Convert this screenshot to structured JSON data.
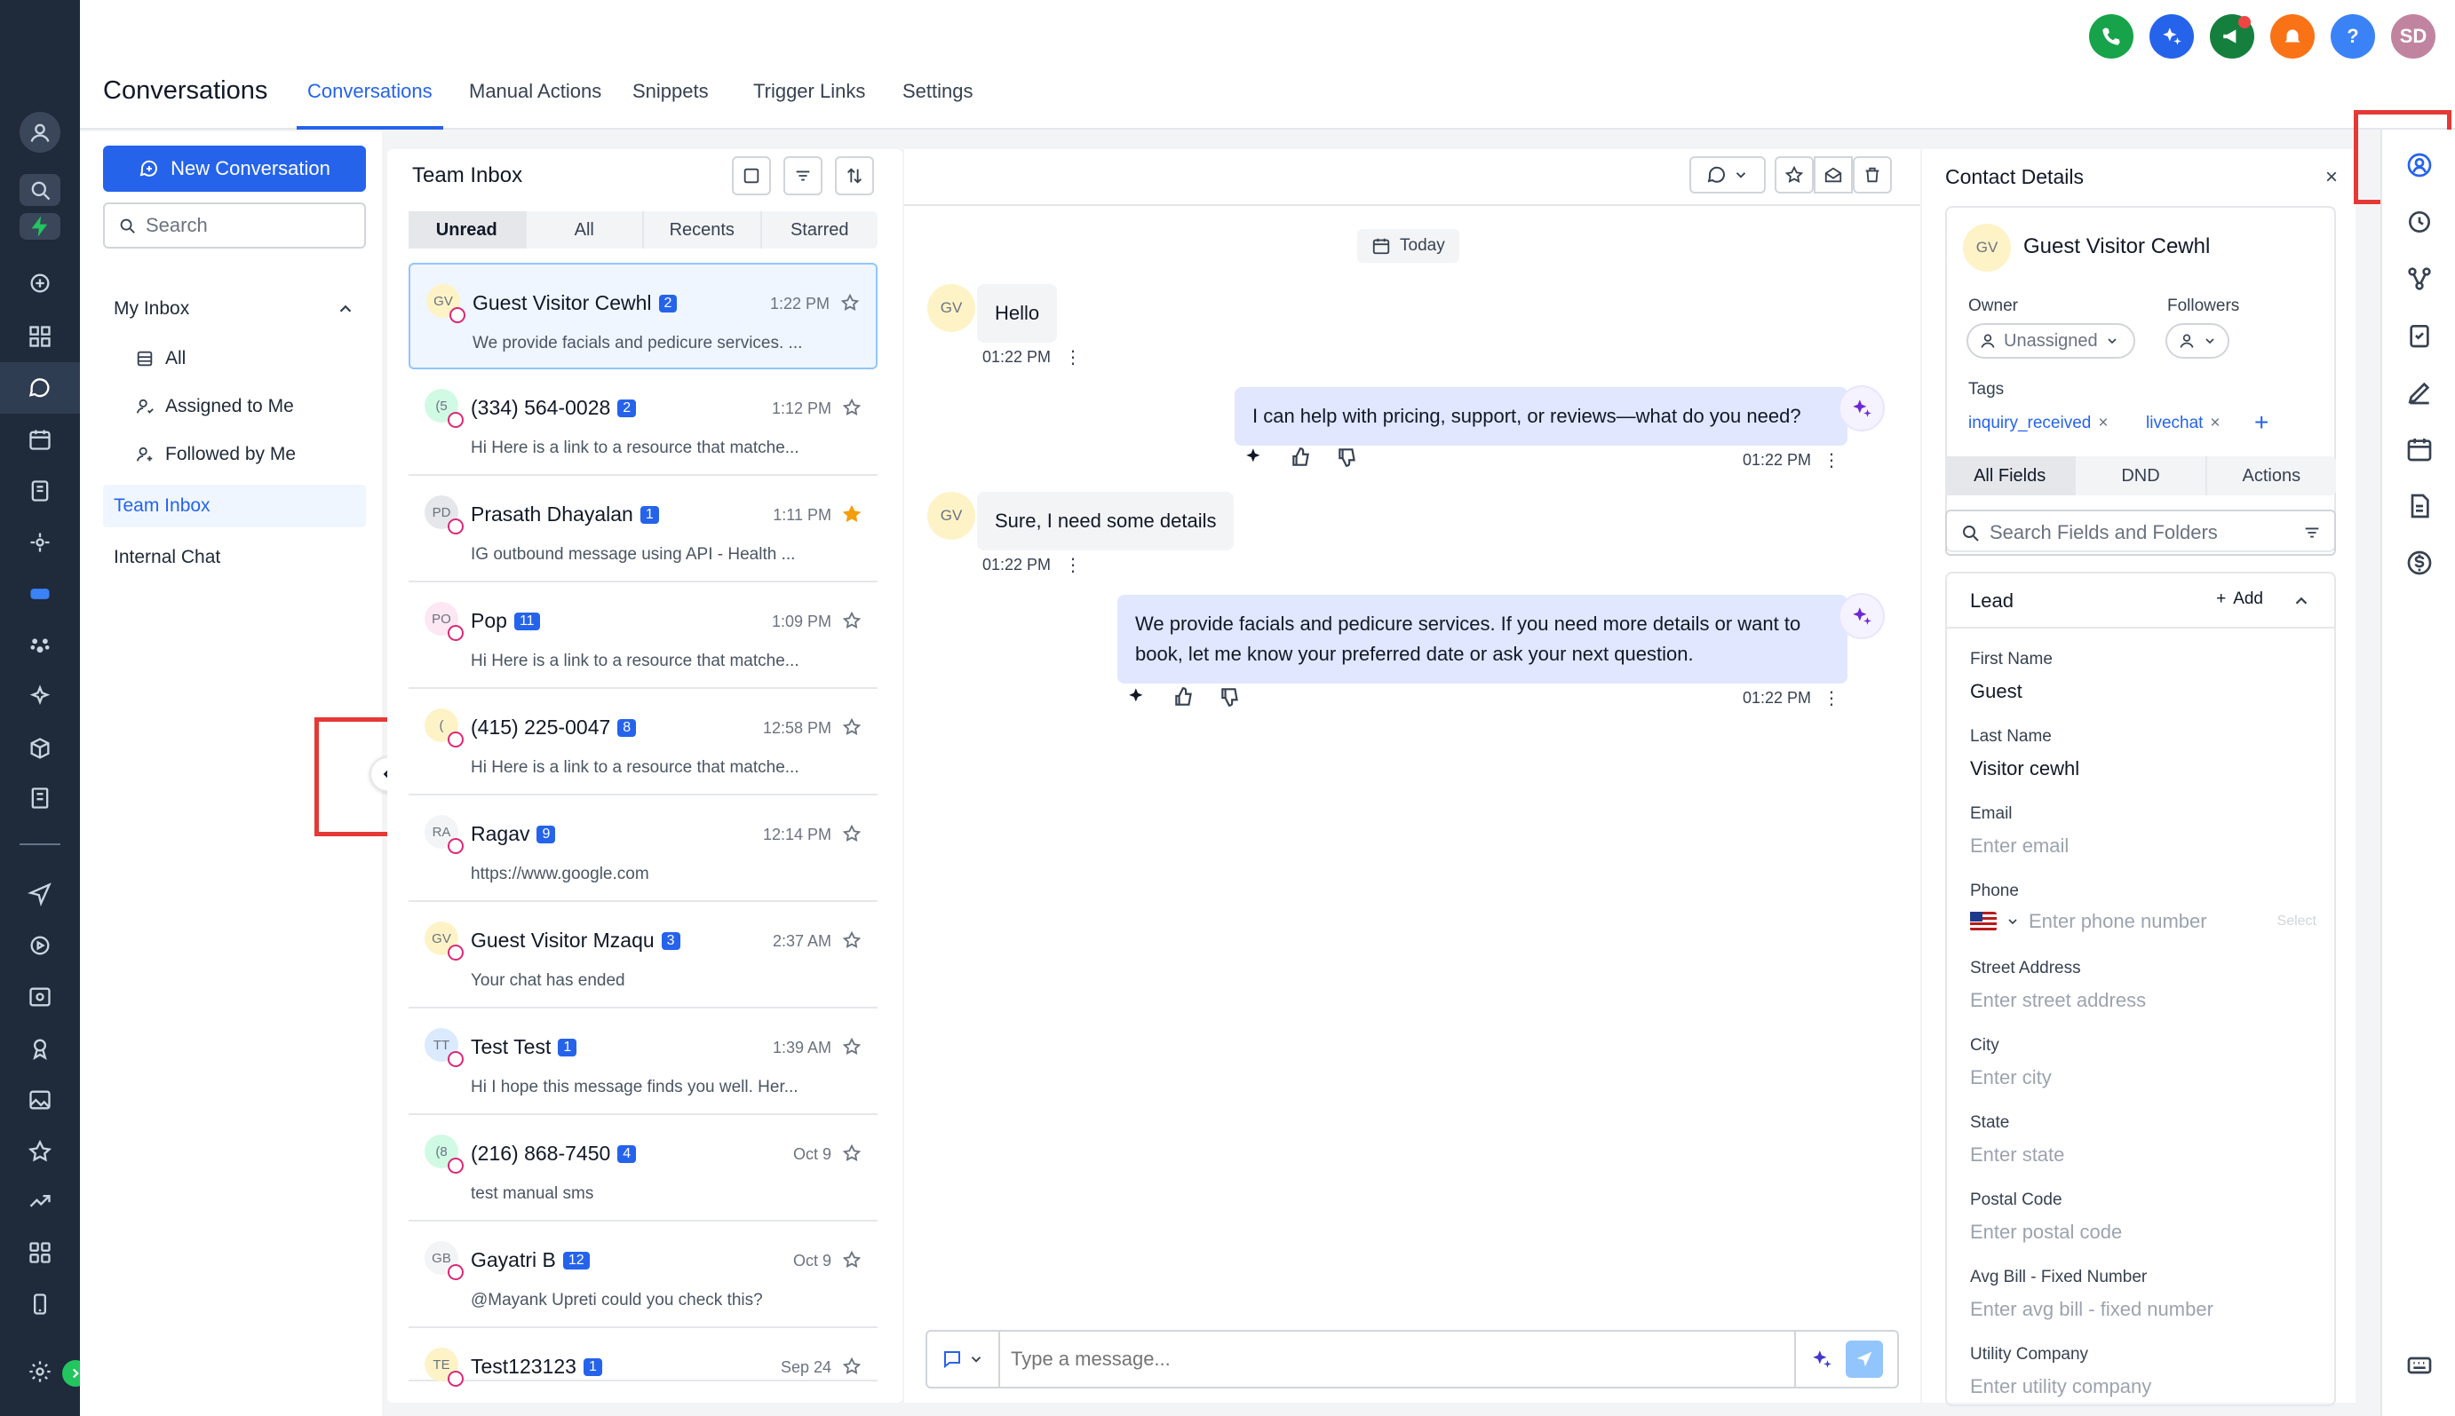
{
  "nav": {
    "title": "Conversations",
    "tabs": [
      "Conversations",
      "Manual Actions",
      "Snippets",
      "Trigger Links",
      "Settings"
    ]
  },
  "topbar": {
    "avatar_initials": "SD",
    "help": "?"
  },
  "sidebar": {
    "new_conversation": "New Conversation",
    "search_placeholder": "Search",
    "my_inbox": "My Inbox",
    "items": [
      "All",
      "Assigned to Me",
      "Followed by Me"
    ],
    "team_inbox": "Team Inbox",
    "internal_chat": "Internal Chat"
  },
  "inbox": {
    "title": "Team Inbox",
    "tabs": [
      "Unread",
      "All",
      "Recents",
      "Starred"
    ],
    "conversations": [
      {
        "initials": "GV",
        "name": "Guest Visitor Cewhl",
        "badge": "2",
        "time": "1:22 PM",
        "preview": "We provide facials and pedicure services. ...",
        "starred": false
      },
      {
        "initials": "(5",
        "name": "(334) 564-0028",
        "badge": "2",
        "time": "1:12 PM",
        "preview": "Hi Here is a link to a resource that matche...",
        "starred": false
      },
      {
        "initials": "PD",
        "name": "Prasath Dhayalan",
        "badge": "1",
        "time": "1:11 PM",
        "preview": "IG outbound message using API - Health ...",
        "starred": true
      },
      {
        "initials": "PO",
        "name": "Pop",
        "badge": "11",
        "time": "1:09 PM",
        "preview": "Hi Here is a link to a resource that matche...",
        "starred": false
      },
      {
        "initials": "(",
        "name": "(415) 225-0047",
        "badge": "8",
        "time": "12:58 PM",
        "preview": "Hi Here is a link to a resource that matche...",
        "starred": false
      },
      {
        "initials": "RA",
        "name": "Ragav",
        "badge": "9",
        "time": "12:14 PM",
        "preview": "https://www.google.com",
        "starred": false
      },
      {
        "initials": "GV",
        "name": "Guest Visitor Mzaqu",
        "badge": "3",
        "time": "2:37 AM",
        "preview": "Your chat has ended",
        "starred": false
      },
      {
        "initials": "TT",
        "name": "Test Test",
        "badge": "1",
        "time": "1:39 AM",
        "preview": "Hi I hope this message finds you well. Her...",
        "starred": false
      },
      {
        "initials": "(8",
        "name": "(216) 868-7450",
        "badge": "4",
        "time": "Oct 9",
        "preview": "test manual sms",
        "starred": false
      },
      {
        "initials": "GB",
        "name": "Gayatri B",
        "badge": "12",
        "time": "Oct 9",
        "preview": "@Mayank Upreti could you check this?",
        "starred": false
      },
      {
        "initials": "TE",
        "name": "Test123123",
        "badge": "1",
        "time": "Sep 24",
        "preview": "",
        "starred": false
      }
    ]
  },
  "chat": {
    "date": "Today",
    "messages": [
      {
        "dir": "in",
        "initials": "GV",
        "text": "Hello",
        "time": "01:22 PM"
      },
      {
        "dir": "out",
        "text": "I can help with pricing, support, or reviews—what do you need?",
        "time": "01:22 PM"
      },
      {
        "dir": "in",
        "initials": "GV",
        "text": "Sure, I need some details",
        "time": "01:22 PM"
      },
      {
        "dir": "out",
        "text": "We provide facials and pedicure services. If you need more details or want to book, let me know your preferred date or ask your next question.",
        "time": "01:22 PM"
      }
    ],
    "composer_placeholder": "Type a message..."
  },
  "contact": {
    "title": "Contact Details",
    "close": "×",
    "initials": "GV",
    "name": "Guest Visitor Cewhl",
    "owner_label": "Owner",
    "owner_value": "Unassigned",
    "followers_label": "Followers",
    "tags_label": "Tags",
    "tags": [
      "inquiry_received",
      "livechat"
    ],
    "tabs": [
      "All Fields",
      "DND",
      "Actions"
    ],
    "field_search_placeholder": "Search Fields and Folders",
    "section": "Lead",
    "add": "Add",
    "phone_select": "Select",
    "fields": [
      {
        "label": "First Name",
        "value": "Guest",
        "placeholder": ""
      },
      {
        "label": "Last Name",
        "value": "Visitor cewhl",
        "placeholder": ""
      },
      {
        "label": "Email",
        "value": "",
        "placeholder": "Enter email"
      },
      {
        "label": "Phone",
        "value": "",
        "placeholder": "Enter phone number"
      },
      {
        "label": "Street Address",
        "value": "",
        "placeholder": "Enter street address"
      },
      {
        "label": "City",
        "value": "",
        "placeholder": "Enter city"
      },
      {
        "label": "State",
        "value": "",
        "placeholder": "Enter state"
      },
      {
        "label": "Postal Code",
        "value": "",
        "placeholder": "Enter postal code"
      },
      {
        "label": "Avg Bill - Fixed Number",
        "value": "",
        "placeholder": "Enter avg bill - fixed number"
      },
      {
        "label": "Utility Company",
        "value": "",
        "placeholder": "Enter utility company"
      }
    ]
  },
  "colors": {
    "accent": "#2563eb",
    "rail": "#1f2a3a",
    "highlight": "#e53935",
    "phone_green": "#16a34a",
    "megaphone_green": "#15803d",
    "bell_orange": "#f97316",
    "help_blue": "#3b82f6",
    "avatar_pink": "#c084a0"
  }
}
